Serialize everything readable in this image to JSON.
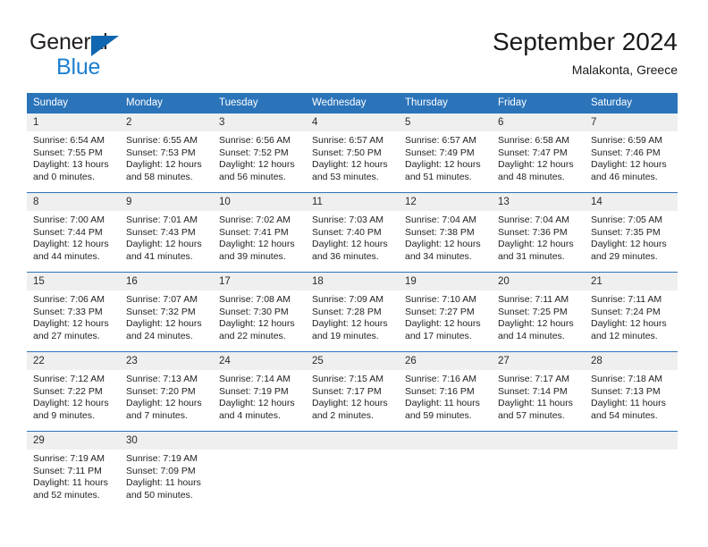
{
  "brand": {
    "word_general": "General",
    "word_blue": "Blue",
    "logo_icon": "triangle-logo-icon",
    "accent_blue": "#1d7fd0",
    "triangle_blue": "#1066b0"
  },
  "header": {
    "title": "September 2024",
    "subtitle": "Malakonta, Greece"
  },
  "calendar": {
    "header_bg": "#2b74ba",
    "daynum_bg": "#efefef",
    "weekday_headers": [
      "Sunday",
      "Monday",
      "Tuesday",
      "Wednesday",
      "Thursday",
      "Friday",
      "Saturday"
    ],
    "weeks": [
      [
        {
          "day": "1",
          "sunrise": "Sunrise: 6:54 AM",
          "sunset": "Sunset: 7:55 PM",
          "daylight": "Daylight: 13 hours and 0 minutes."
        },
        {
          "day": "2",
          "sunrise": "Sunrise: 6:55 AM",
          "sunset": "Sunset: 7:53 PM",
          "daylight": "Daylight: 12 hours and 58 minutes."
        },
        {
          "day": "3",
          "sunrise": "Sunrise: 6:56 AM",
          "sunset": "Sunset: 7:52 PM",
          "daylight": "Daylight: 12 hours and 56 minutes."
        },
        {
          "day": "4",
          "sunrise": "Sunrise: 6:57 AM",
          "sunset": "Sunset: 7:50 PM",
          "daylight": "Daylight: 12 hours and 53 minutes."
        },
        {
          "day": "5",
          "sunrise": "Sunrise: 6:57 AM",
          "sunset": "Sunset: 7:49 PM",
          "daylight": "Daylight: 12 hours and 51 minutes."
        },
        {
          "day": "6",
          "sunrise": "Sunrise: 6:58 AM",
          "sunset": "Sunset: 7:47 PM",
          "daylight": "Daylight: 12 hours and 48 minutes."
        },
        {
          "day": "7",
          "sunrise": "Sunrise: 6:59 AM",
          "sunset": "Sunset: 7:46 PM",
          "daylight": "Daylight: 12 hours and 46 minutes."
        }
      ],
      [
        {
          "day": "8",
          "sunrise": "Sunrise: 7:00 AM",
          "sunset": "Sunset: 7:44 PM",
          "daylight": "Daylight: 12 hours and 44 minutes."
        },
        {
          "day": "9",
          "sunrise": "Sunrise: 7:01 AM",
          "sunset": "Sunset: 7:43 PM",
          "daylight": "Daylight: 12 hours and 41 minutes."
        },
        {
          "day": "10",
          "sunrise": "Sunrise: 7:02 AM",
          "sunset": "Sunset: 7:41 PM",
          "daylight": "Daylight: 12 hours and 39 minutes."
        },
        {
          "day": "11",
          "sunrise": "Sunrise: 7:03 AM",
          "sunset": "Sunset: 7:40 PM",
          "daylight": "Daylight: 12 hours and 36 minutes."
        },
        {
          "day": "12",
          "sunrise": "Sunrise: 7:04 AM",
          "sunset": "Sunset: 7:38 PM",
          "daylight": "Daylight: 12 hours and 34 minutes."
        },
        {
          "day": "13",
          "sunrise": "Sunrise: 7:04 AM",
          "sunset": "Sunset: 7:36 PM",
          "daylight": "Daylight: 12 hours and 31 minutes."
        },
        {
          "day": "14",
          "sunrise": "Sunrise: 7:05 AM",
          "sunset": "Sunset: 7:35 PM",
          "daylight": "Daylight: 12 hours and 29 minutes."
        }
      ],
      [
        {
          "day": "15",
          "sunrise": "Sunrise: 7:06 AM",
          "sunset": "Sunset: 7:33 PM",
          "daylight": "Daylight: 12 hours and 27 minutes."
        },
        {
          "day": "16",
          "sunrise": "Sunrise: 7:07 AM",
          "sunset": "Sunset: 7:32 PM",
          "daylight": "Daylight: 12 hours and 24 minutes."
        },
        {
          "day": "17",
          "sunrise": "Sunrise: 7:08 AM",
          "sunset": "Sunset: 7:30 PM",
          "daylight": "Daylight: 12 hours and 22 minutes."
        },
        {
          "day": "18",
          "sunrise": "Sunrise: 7:09 AM",
          "sunset": "Sunset: 7:28 PM",
          "daylight": "Daylight: 12 hours and 19 minutes."
        },
        {
          "day": "19",
          "sunrise": "Sunrise: 7:10 AM",
          "sunset": "Sunset: 7:27 PM",
          "daylight": "Daylight: 12 hours and 17 minutes."
        },
        {
          "day": "20",
          "sunrise": "Sunrise: 7:11 AM",
          "sunset": "Sunset: 7:25 PM",
          "daylight": "Daylight: 12 hours and 14 minutes."
        },
        {
          "day": "21",
          "sunrise": "Sunrise: 7:11 AM",
          "sunset": "Sunset: 7:24 PM",
          "daylight": "Daylight: 12 hours and 12 minutes."
        }
      ],
      [
        {
          "day": "22",
          "sunrise": "Sunrise: 7:12 AM",
          "sunset": "Sunset: 7:22 PM",
          "daylight": "Daylight: 12 hours and 9 minutes."
        },
        {
          "day": "23",
          "sunrise": "Sunrise: 7:13 AM",
          "sunset": "Sunset: 7:20 PM",
          "daylight": "Daylight: 12 hours and 7 minutes."
        },
        {
          "day": "24",
          "sunrise": "Sunrise: 7:14 AM",
          "sunset": "Sunset: 7:19 PM",
          "daylight": "Daylight: 12 hours and 4 minutes."
        },
        {
          "day": "25",
          "sunrise": "Sunrise: 7:15 AM",
          "sunset": "Sunset: 7:17 PM",
          "daylight": "Daylight: 12 hours and 2 minutes."
        },
        {
          "day": "26",
          "sunrise": "Sunrise: 7:16 AM",
          "sunset": "Sunset: 7:16 PM",
          "daylight": "Daylight: 11 hours and 59 minutes."
        },
        {
          "day": "27",
          "sunrise": "Sunrise: 7:17 AM",
          "sunset": "Sunset: 7:14 PM",
          "daylight": "Daylight: 11 hours and 57 minutes."
        },
        {
          "day": "28",
          "sunrise": "Sunrise: 7:18 AM",
          "sunset": "Sunset: 7:13 PM",
          "daylight": "Daylight: 11 hours and 54 minutes."
        }
      ],
      [
        {
          "day": "29",
          "sunrise": "Sunrise: 7:19 AM",
          "sunset": "Sunset: 7:11 PM",
          "daylight": "Daylight: 11 hours and 52 minutes."
        },
        {
          "day": "30",
          "sunrise": "Sunrise: 7:19 AM",
          "sunset": "Sunset: 7:09 PM",
          "daylight": "Daylight: 11 hours and 50 minutes."
        },
        {
          "day": "",
          "sunrise": "",
          "sunset": "",
          "daylight": ""
        },
        {
          "day": "",
          "sunrise": "",
          "sunset": "",
          "daylight": ""
        },
        {
          "day": "",
          "sunrise": "",
          "sunset": "",
          "daylight": ""
        },
        {
          "day": "",
          "sunrise": "",
          "sunset": "",
          "daylight": ""
        },
        {
          "day": "",
          "sunrise": "",
          "sunset": "",
          "daylight": ""
        }
      ]
    ]
  }
}
